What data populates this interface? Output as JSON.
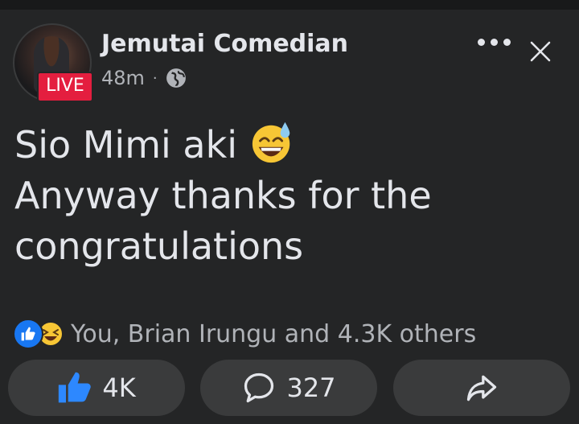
{
  "post": {
    "author": "Jemutai Comedian",
    "live_badge": "LIVE",
    "time": "48m",
    "separator": "·",
    "lines": [
      "Sio Mimi aki",
      "Anyway thanks for the",
      "congratulations"
    ],
    "emoji": "grinning-face-with-sweat-emoji"
  },
  "reactions": {
    "text": "You, Brian Irungu and 4.3K others",
    "types": [
      "like",
      "haha"
    ]
  },
  "actions": {
    "like_count": "4K",
    "comment_count": "327",
    "share_label": ""
  },
  "icons": {
    "privacy": "globe-icon",
    "menu": "more-options-icon",
    "close": "close-icon",
    "like": "thumbs-up-icon",
    "comment": "comment-bubble-icon",
    "share": "share-arrow-icon"
  },
  "colors": {
    "background": "#242526",
    "button": "#3a3b3c",
    "primary_text": "#e4e6eb",
    "secondary_text": "#b0b3b8",
    "like_blue": "#1877f2",
    "live_red": "#e41e3f"
  }
}
